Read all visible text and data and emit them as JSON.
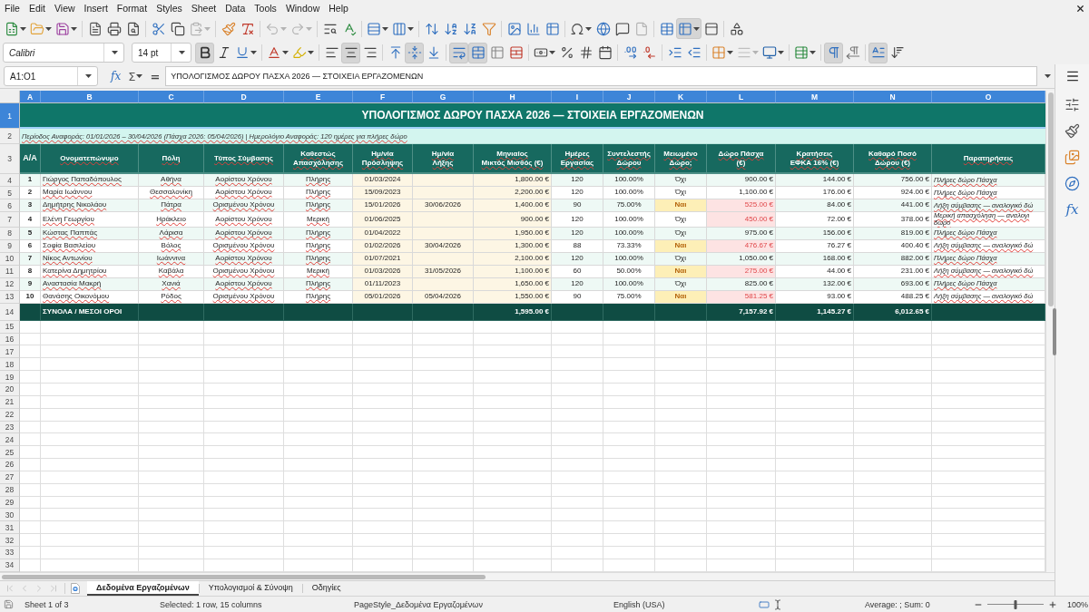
{
  "menu_bar": {
    "items": [
      "File",
      "Edit",
      "View",
      "Insert",
      "Format",
      "Styles",
      "Sheet",
      "Data",
      "Tools",
      "Window",
      "Help"
    ]
  },
  "standard_toolbar": {
    "groups": [
      [
        {
          "kind": "new",
          "pressed": false,
          "disabled": false
        },
        {
          "kind": "open",
          "pressed": false,
          "disabled": false
        },
        {
          "kind": "save",
          "pressed": false,
          "disabled": false
        }
      ],
      [
        {
          "kind": "pdf",
          "pressed": false,
          "disabled": false
        },
        {
          "kind": "print",
          "pressed": false,
          "disabled": false
        },
        {
          "kind": "preview",
          "pressed": false,
          "disabled": false
        }
      ],
      [
        {
          "kind": "cut",
          "pressed": false,
          "disabled": false
        },
        {
          "kind": "copy",
          "pressed": false,
          "disabled": false
        },
        {
          "kind": "paste",
          "pressed": false,
          "disabled": true
        }
      ],
      [
        {
          "kind": "clone",
          "pressed": false,
          "disabled": false
        },
        {
          "kind": "clear",
          "pressed": false,
          "disabled": false
        }
      ],
      [
        {
          "kind": "undo",
          "pressed": false,
          "disabled": true
        },
        {
          "kind": "redo",
          "pressed": false,
          "disabled": true
        }
      ],
      [
        {
          "kind": "find",
          "pressed": false,
          "disabled": false
        },
        {
          "kind": "spelling",
          "pressed": false,
          "disabled": false
        }
      ],
      [
        {
          "kind": "rows",
          "pressed": false,
          "disabled": false
        },
        {
          "kind": "columns",
          "pressed": false,
          "disabled": false
        }
      ],
      [
        {
          "kind": "sort",
          "pressed": false,
          "disabled": false
        },
        {
          "kind": "ascending",
          "pressed": false,
          "disabled": false
        },
        {
          "kind": "descending",
          "pressed": false,
          "disabled": false
        },
        {
          "kind": "autofilter",
          "pressed": false,
          "disabled": false
        }
      ],
      [
        {
          "kind": "image",
          "pressed": false,
          "disabled": false
        },
        {
          "kind": "chart",
          "pressed": false,
          "disabled": false
        },
        {
          "kind": "pivot",
          "pressed": false,
          "disabled": false
        }
      ],
      [
        {
          "kind": "special",
          "pressed": false,
          "disabled": false
        },
        {
          "kind": "hyperlink",
          "pressed": false,
          "disabled": false
        },
        {
          "kind": "comment",
          "pressed": false,
          "disabled": false
        },
        {
          "kind": "headers",
          "pressed": false,
          "disabled": true
        }
      ],
      [
        {
          "kind": "printarea",
          "pressed": false,
          "disabled": false
        },
        {
          "kind": "freeze",
          "pressed": true,
          "disabled": false
        },
        {
          "kind": "split",
          "pressed": false,
          "disabled": false
        }
      ],
      [
        {
          "kind": "draw",
          "pressed": false,
          "disabled": false
        }
      ]
    ]
  },
  "formatting_toolbar": {
    "font_name": "Calibri",
    "font_size": "14 pt",
    "groups": [
      [
        {
          "kind": "bold",
          "pressed": true,
          "disabled": false
        },
        {
          "kind": "italic",
          "pressed": false,
          "disabled": false
        },
        {
          "kind": "underline",
          "pressed": false,
          "disabled": false
        }
      ],
      [
        {
          "kind": "fontcolor",
          "pressed": false,
          "disabled": false
        },
        {
          "kind": "highlight",
          "pressed": false,
          "disabled": false
        }
      ],
      [
        {
          "kind": "alignleft",
          "pressed": false,
          "disabled": false
        },
        {
          "kind": "aligncenter",
          "pressed": true,
          "disabled": false
        },
        {
          "kind": "alignright",
          "pressed": false,
          "disabled": false
        }
      ],
      [
        {
          "kind": "aligntop",
          "pressed": false,
          "disabled": false
        },
        {
          "kind": "alignmiddle",
          "pressed": true,
          "disabled": false
        },
        {
          "kind": "alignbottom",
          "pressed": false,
          "disabled": false
        }
      ],
      [
        {
          "kind": "wrap",
          "pressed": true,
          "disabled": false
        },
        {
          "kind": "mergecenter",
          "pressed": true,
          "disabled": false
        },
        {
          "kind": "merge",
          "pressed": false,
          "disabled": false
        },
        {
          "kind": "unmerge",
          "pressed": false,
          "disabled": false
        }
      ],
      [
        {
          "kind": "numberformat",
          "pressed": false,
          "disabled": false
        },
        {
          "kind": "percent",
          "pressed": false,
          "disabled": false
        },
        {
          "kind": "number",
          "pressed": false,
          "disabled": false
        },
        {
          "kind": "date",
          "pressed": false,
          "disabled": false
        }
      ],
      [
        {
          "kind": "adddecimal",
          "pressed": false,
          "disabled": false
        },
        {
          "kind": "deletedecimal",
          "pressed": false,
          "disabled": false
        }
      ],
      [
        {
          "kind": "indent",
          "pressed": false,
          "disabled": false
        },
        {
          "kind": "outdent",
          "pressed": false,
          "disabled": false
        }
      ],
      [
        {
          "kind": "borders",
          "pressed": false,
          "disabled": false
        },
        {
          "kind": "borderstyle",
          "pressed": false,
          "disabled": true
        },
        {
          "kind": "bordercolor",
          "pressed": false,
          "disabled": false
        }
      ],
      [
        {
          "kind": "conditional",
          "pressed": false,
          "disabled": false
        }
      ],
      [
        {
          "kind": "ltr",
          "pressed": true,
          "disabled": false
        },
        {
          "kind": "rtl",
          "pressed": false,
          "disabled": false
        }
      ],
      [
        {
          "kind": "horizontaltext",
          "pressed": true,
          "disabled": false
        },
        {
          "kind": "verticaltext",
          "pressed": false,
          "disabled": false
        }
      ]
    ]
  },
  "formula_bar": {
    "name_box": "A1:O1",
    "wizard": "fx",
    "sum": "Σ",
    "equals": "=",
    "content": "ΥΠΟΛΟΓΙΣΜΟΣ ΔΩΡΟΥ ΠΑΣΧΑ 2026 — ΣΤΟΙΧΕΙΑ ΕΡΓΑΖΟΜΕΝΩΝ"
  },
  "sheet": {
    "spelling_marks": true,
    "column_letters": [
      {
        "label": "A",
        "selected": true
      },
      {
        "label": "B",
        "selected": true
      },
      {
        "label": "C",
        "selected": true
      },
      {
        "label": "D",
        "selected": true
      },
      {
        "label": "E",
        "selected": true
      },
      {
        "label": "F",
        "selected": true
      },
      {
        "label": "G",
        "selected": true
      },
      {
        "label": "H",
        "selected": true
      },
      {
        "label": "I",
        "selected": true
      },
      {
        "label": "J",
        "selected": true
      },
      {
        "label": "K",
        "selected": true
      },
      {
        "label": "L",
        "selected": true
      },
      {
        "label": "M",
        "selected": true
      },
      {
        "label": "N",
        "selected": true
      },
      {
        "label": "O",
        "selected": true
      }
    ],
    "row_numbers": [
      {
        "label": "1",
        "selected": true
      },
      {
        "label": "2",
        "selected": false
      },
      {
        "label": "3",
        "selected": false
      },
      {
        "label": "4",
        "selected": false
      },
      {
        "label": "5",
        "selected": false
      },
      {
        "label": "6",
        "selected": false
      },
      {
        "label": "7",
        "selected": false
      },
      {
        "label": "8",
        "selected": false
      },
      {
        "label": "9",
        "selected": false
      },
      {
        "label": "10",
        "selected": false
      },
      {
        "label": "11",
        "selected": false
      },
      {
        "label": "12",
        "selected": false
      },
      {
        "label": "13",
        "selected": false
      },
      {
        "label": "14",
        "selected": false
      },
      {
        "label": "15",
        "selected": false
      },
      {
        "label": "16",
        "selected": false
      },
      {
        "label": "17",
        "selected": false
      },
      {
        "label": "18",
        "selected": false
      },
      {
        "label": "19",
        "selected": false
      },
      {
        "label": "20",
        "selected": false
      },
      {
        "label": "21",
        "selected": false
      },
      {
        "label": "22",
        "selected": false
      },
      {
        "label": "23",
        "selected": false
      },
      {
        "label": "24",
        "selected": false
      },
      {
        "label": "25",
        "selected": false
      },
      {
        "label": "26",
        "selected": false
      },
      {
        "label": "27",
        "selected": false
      },
      {
        "label": "28",
        "selected": false
      },
      {
        "label": "29",
        "selected": false
      },
      {
        "label": "30",
        "selected": false
      },
      {
        "label": "31",
        "selected": false
      },
      {
        "label": "32",
        "selected": false
      },
      {
        "label": "33",
        "selected": false
      },
      {
        "label": "34",
        "selected": false
      }
    ],
    "title": "ΥΠΟΛΟΓΙΣΜΟΣ ΔΩΡΟΥ ΠΑΣΧΑ 2026 — ΣΤΟΙΧΕΙΑ ΕΡΓΑΖΟΜΕΝΩΝ",
    "period": "Περίοδος Αναφοράς: 01/01/2026 – 30/04/2026 (Πάσχα 2026: 05/04/2026) | Ημερολόγιο Αναφοράς: 120 ημέρες για πλήρες δώρο",
    "headers": [
      "Α/Α",
      "Ονοματεπώνυμο",
      "Πόλη",
      "Τύπος Σύμβασης",
      "Καθεστώς\nΑπασχόλησης",
      "Ημ/νία\nΠρόσληψης",
      "Ημ/νία\nΛήξης",
      "Μηνιαίος\nΜικτός Μισθός (€)",
      "Ημέρες\nΕργασίας",
      "Συντελεστής\nΔώρου",
      "Μειωμένο\nΔώρο;",
      "Δώρο Πάσχα\n(€)",
      "Κρατήσεις\nΕΦΚΑ 16% (€)",
      "Καθαρό Ποσό\nΔώρου (€)",
      "Παρατηρήσεις"
    ],
    "employees": [
      {
        "no": "1",
        "name": "Γιώργος Παπαδόπουλος",
        "city": "Αθήνα",
        "contract": "Αορίστου Χρόνου",
        "employment": "Πλήρης",
        "hire_date": "01/03/2024",
        "salary": "1,800.00 €",
        "days": "120",
        "factor": "100.00%",
        "reduced": {
          "text": "Όχι",
          "highlighted": false
        },
        "gift": {
          "text": "900.00 €",
          "highlighted": false
        },
        "deduction": "144.00 €",
        "net": "756.00 €",
        "note": "Πλήρες δώρο Πάσχα"
      },
      {
        "no": "2",
        "name": "Μαρία Ιωάννου",
        "city": "Θεσσαλονίκη",
        "contract": "Αορίστου Χρόνου",
        "employment": "Πλήρης",
        "hire_date": "15/09/2023",
        "salary": "2,200.00 €",
        "days": "120",
        "factor": "100.00%",
        "reduced": {
          "text": "Όχι",
          "highlighted": false
        },
        "gift": {
          "text": "1,100.00 €",
          "highlighted": false
        },
        "deduction": "176.00 €",
        "net": "924.00 €",
        "note": "Πλήρες δώρο Πάσχα"
      },
      {
        "no": "3",
        "name": "Δημήτρης Νικολάου",
        "city": "Πάτρα",
        "contract": "Ορισμένου Χρόνου",
        "employment": "Πλήρης",
        "hire_date": "15/01/2026",
        "end_date": "30/06/2026",
        "salary": "1,400.00 €",
        "days": "90",
        "factor": "75.00%",
        "reduced": {
          "text": "Ναι",
          "highlighted": true
        },
        "gift": {
          "text": "525.00 €",
          "highlighted": true
        },
        "deduction": "84.00 €",
        "net": "441.00 €",
        "note": "Λήξη σύμβασης — αναλογικό δώ"
      },
      {
        "no": "4",
        "name": "Ελένη Γεωργίου",
        "city": "Ηράκλειο",
        "contract": "Αορίστου Χρόνου",
        "employment": "Μερική",
        "hire_date": "01/06/2025",
        "salary": "900.00 €",
        "days": "120",
        "factor": "100.00%",
        "reduced": {
          "text": "Όχι",
          "highlighted": false
        },
        "gift": {
          "text": "450.00 €",
          "highlighted": true
        },
        "deduction": "72.00 €",
        "net": "378.00 €",
        "note": "Μερική απασχόληση — αναλογι\nδώρο"
      },
      {
        "no": "5",
        "name": "Κώστας Παππάς",
        "city": "Λάρισα",
        "contract": "Αορίστου Χρόνου",
        "employment": "Πλήρης",
        "hire_date": "01/04/2022",
        "salary": "1,950.00 €",
        "days": "120",
        "factor": "100.00%",
        "reduced": {
          "text": "Όχι",
          "highlighted": false
        },
        "gift": {
          "text": "975.00 €",
          "highlighted": false
        },
        "deduction": "156.00 €",
        "net": "819.00 €",
        "note": "Πλήρες δώρο Πάσχα"
      },
      {
        "no": "6",
        "name": "Σοφία Βασιλείου",
        "city": "Βόλος",
        "contract": "Ορισμένου Χρόνου",
        "employment": "Πλήρης",
        "hire_date": "01/02/2026",
        "end_date": "30/04/2026",
        "salary": "1,300.00 €",
        "days": "88",
        "factor": "73.33%",
        "reduced": {
          "text": "Ναι",
          "highlighted": true
        },
        "gift": {
          "text": "476.67 €",
          "highlighted": true
        },
        "deduction": "76.27 €",
        "net": "400.40 €",
        "note": "Λήξη σύμβασης — αναλογικό δώ"
      },
      {
        "no": "7",
        "name": "Νίκος Αντωνίου",
        "city": "Ιωάννινα",
        "contract": "Αορίστου Χρόνου",
        "employment": "Πλήρης",
        "hire_date": "01/07/2021",
        "salary": "2,100.00 €",
        "days": "120",
        "factor": "100.00%",
        "reduced": {
          "text": "Όχι",
          "highlighted": false
        },
        "gift": {
          "text": "1,050.00 €",
          "highlighted": false
        },
        "deduction": "168.00 €",
        "net": "882.00 €",
        "note": "Πλήρες δώρο Πάσχα"
      },
      {
        "no": "8",
        "name": "Κατερίνα Δημητρίου",
        "city": "Καβάλα",
        "contract": "Ορισμένου Χρόνου",
        "employment": "Μερική",
        "hire_date": "01/03/2026",
        "end_date": "31/05/2026",
        "salary": "1,100.00 €",
        "days": "60",
        "factor": "50.00%",
        "reduced": {
          "text": "Ναι",
          "highlighted": true
        },
        "gift": {
          "text": "275.00 €",
          "highlighted": true
        },
        "deduction": "44.00 €",
        "net": "231.00 €",
        "note": "Λήξη σύμβασης — αναλογικό δώ"
      },
      {
        "no": "9",
        "name": "Αναστασία Μακρή",
        "city": "Χανιά",
        "contract": "Αορίστου Χρόνου",
        "employment": "Πλήρης",
        "hire_date": "01/11/2023",
        "salary": "1,650.00 €",
        "days": "120",
        "factor": "100.00%",
        "reduced": {
          "text": "Όχι",
          "highlighted": false
        },
        "gift": {
          "text": "825.00 €",
          "highlighted": false
        },
        "deduction": "132.00 €",
        "net": "693.00 €",
        "note": "Πλήρες δώρο Πάσχα"
      },
      {
        "no": "10",
        "name": "Θανάσης Οικονόμου",
        "city": "Ρόδος",
        "contract": "Ορισμένου Χρόνου",
        "employment": "Πλήρης",
        "hire_date": "05/01/2026",
        "end_date": "05/04/2026",
        "salary": "1,550.00 €",
        "days": "90",
        "factor": "75.00%",
        "reduced": {
          "text": "Ναι",
          "highlighted": true
        },
        "gift": {
          "text": "581.25 €",
          "highlighted": true
        },
        "deduction": "93.00 €",
        "net": "488.25 €",
        "note": "Λήξη σύμβασης — αναλογικό δώ"
      }
    ],
    "totals": {
      "label": "ΣΥΝΟΛΑ / ΜΕΣΟΙ ΟΡΟΙ",
      "salary": "1,595.00 €",
      "gift": "7,157.92 €",
      "deduction": "1,145.27 €",
      "net": "6,012.65 €"
    }
  },
  "sheet_tabs": {
    "navigation": [
      {
        "kind": "first",
        "disabled": true
      },
      {
        "kind": "previous",
        "disabled": true
      },
      {
        "kind": "next",
        "disabled": true
      },
      {
        "kind": "last",
        "disabled": true
      }
    ],
    "tabs": [
      {
        "label": "Δεδομένα Εργαζομένων",
        "selected": true
      },
      {
        "label": "Υπολογισμοί & Σύνοψη",
        "selected": false
      },
      {
        "label": "Οδηγίες",
        "selected": false
      }
    ]
  },
  "sidebar": {
    "tabs": [
      {
        "kind": "properties",
        "selected": false
      },
      {
        "kind": "styles",
        "selected": false
      },
      {
        "kind": "gallery",
        "selected": false
      },
      {
        "kind": "navigator",
        "selected": false
      },
      {
        "kind": "functions",
        "glyph": "fx",
        "selected": false
      }
    ]
  },
  "status_bar": {
    "sheet": "Sheet 1 of 3",
    "selection": "Selected: 1 row, 15 columns",
    "page_style": "PageStyle_Δεδομένα Εργαζομένων",
    "language": "English (USA)",
    "summary": "Average: ; Sum: 0",
    "zoom": {
      "level": 0.5,
      "reading": "100%"
    }
  }
}
